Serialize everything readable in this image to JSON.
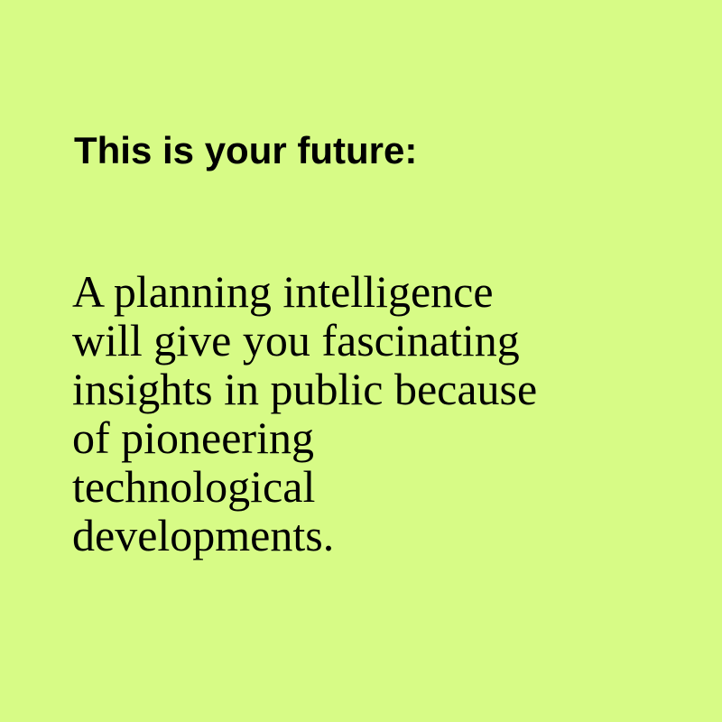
{
  "background_color": "#d7fb86",
  "text_color": "#000000",
  "heading": "This is your future:",
  "body_lines": [
    "A planning intelligence",
    "will give you fascinating",
    "insights in public because",
    "of pioneering",
    "technological",
    "developments."
  ]
}
